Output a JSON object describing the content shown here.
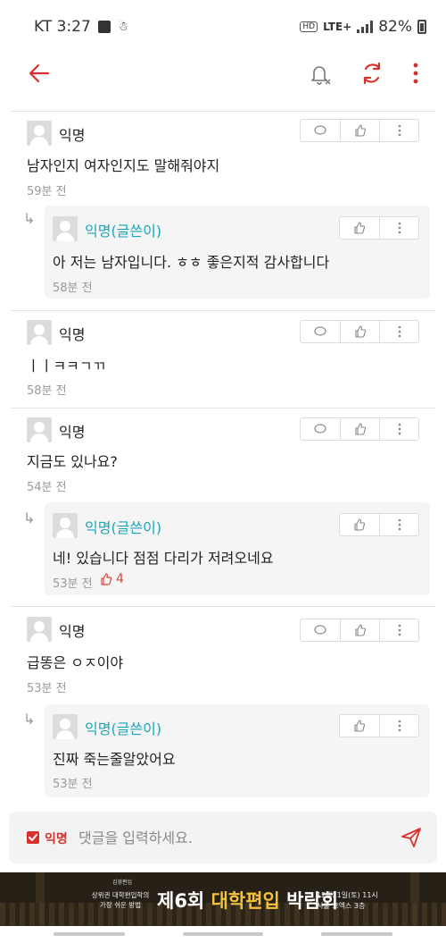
{
  "status_bar": {
    "carrier_time": "KT 3:27",
    "hd": "HD",
    "network": "LTE+",
    "battery": "82%"
  },
  "colors": {
    "accent": "#d6312d",
    "op_author": "#1aa6b7",
    "like": "#e0453a"
  },
  "app_bar": {
    "icons": [
      "back-arrow-icon",
      "notification-off-icon",
      "refresh-icon",
      "more-vertical-icon"
    ]
  },
  "comments": [
    {
      "author": "익명",
      "text": "남자인지 여자인지도 말해줘야지",
      "time": "59분 전",
      "replies": [
        {
          "author": "익명(글쓴이)",
          "text": "아 저는 남자입니다. ㅎㅎ 좋은지적 감사합니다",
          "time": "58분 전"
        }
      ]
    },
    {
      "author": "익명",
      "text": "ㅣㅣㅋㅋㄱㄲ",
      "time": "58분 전",
      "replies": []
    },
    {
      "author": "익명",
      "text": "지금도 있나요?",
      "time": "54분 전",
      "replies": [
        {
          "author": "익명(글쓴이)",
          "text": "네! 있습니다 점점 다리가 저려오네요",
          "time": "53분 전",
          "likes": "4"
        }
      ]
    },
    {
      "author": "익명",
      "text": "급똥은 ㅇㅈ이야",
      "time": "53분 전",
      "replies": [
        {
          "author": "익명(글쓴이)",
          "text": "진짜 죽는줄알았어요",
          "time": "53분 전"
        }
      ]
    }
  ],
  "input": {
    "anon_label": "익명",
    "anon_checked": true,
    "placeholder": "댓글을 입력하세요."
  },
  "ad": {
    "logo": "김영편입",
    "line1": "상위권 대학편입학의",
    "line2": "가장 쉬운 방법",
    "headline_number": "제6회",
    "headline_accent": "대학편입",
    "headline_rest": "박람회",
    "date": "12월21일(토) 11시",
    "venue": "서울 코엑스 3층"
  }
}
